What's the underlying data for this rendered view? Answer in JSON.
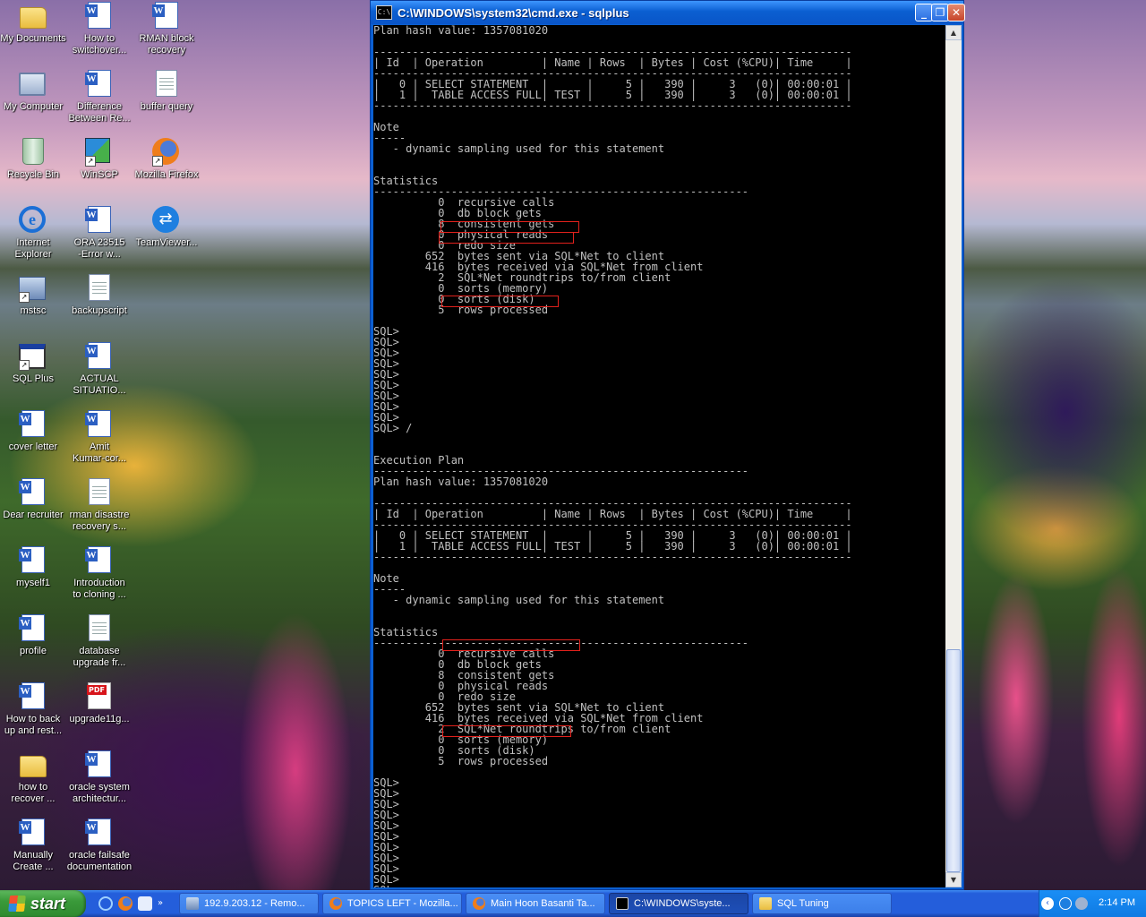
{
  "desktop": {
    "icons": [
      {
        "label": "My Documents",
        "icon": "my-documents-icon"
      },
      {
        "label": "How to\nswitchover...",
        "icon": "word-document-icon"
      },
      {
        "label": "RMAN block\nrecovery",
        "icon": "word-document-icon"
      },
      {
        "label": "My Computer",
        "icon": "my-computer-icon"
      },
      {
        "label": "Difference\nBetween Re...",
        "icon": "word-document-icon"
      },
      {
        "label": "buffer query",
        "icon": "text-document-icon"
      },
      {
        "label": "Recycle Bin",
        "icon": "recycle-bin-icon"
      },
      {
        "label": "WinSCP",
        "icon": "winscp-icon"
      },
      {
        "label": "Mozilla Firefox",
        "icon": "firefox-icon"
      },
      {
        "label": "Internet\nExplorer",
        "icon": "internet-explorer-icon"
      },
      {
        "label": "ORA 23515\n-Error w...",
        "icon": "word-document-icon"
      },
      {
        "label": "TeamViewer...",
        "icon": "teamviewer-icon"
      },
      {
        "label": "mstsc",
        "icon": "remote-desktop-icon"
      },
      {
        "label": "backupscript",
        "icon": "text-document-icon"
      },
      {
        "label": "SQL Plus",
        "icon": "sqlplus-icon"
      },
      {
        "label": "ACTUAL\nSITUATIO...",
        "icon": "word-document-icon"
      },
      {
        "label": "cover letter",
        "icon": "word-document-icon"
      },
      {
        "label": "Amit\nKumar-cor...",
        "icon": "word-document-icon"
      },
      {
        "label": "Dear recruiter",
        "icon": "word-document-icon"
      },
      {
        "label": "rman disastre\nrecovery s...",
        "icon": "text-document-icon"
      },
      {
        "label": "myself1",
        "icon": "word-document-icon"
      },
      {
        "label": "Introduction\nto cloning ...",
        "icon": "word-document-icon"
      },
      {
        "label": "profile",
        "icon": "word-document-icon"
      },
      {
        "label": "database\nupgrade fr...",
        "icon": "text-document-icon"
      },
      {
        "label": "How to back\nup and rest...",
        "icon": "word-document-icon"
      },
      {
        "label": "upgrade11g...",
        "icon": "pdf-document-icon"
      },
      {
        "label": "how to\nrecover ...",
        "icon": "folder-icon"
      },
      {
        "label": "oracle system\narchitectur...",
        "icon": "word-document-icon"
      },
      {
        "label": "Manually\nCreate ...",
        "icon": "word-document-icon"
      },
      {
        "label": "oracle failsafe\ndocumentation",
        "icon": "word-document-icon"
      }
    ]
  },
  "window": {
    "title": "C:\\WINDOWS\\system32\\cmd.exe - sqlplus",
    "icon_text": "C:\\",
    "minimize": "_",
    "maximize": "❐",
    "close": "✕",
    "console_text": "Plan hash value: 1357081020\n\n--------------------------------------------------------------------------\n| Id  | Operation         | Name | Rows  | Bytes | Cost (%CPU)| Time     |\n--------------------------------------------------------------------------\n|   0 | SELECT STATEMENT  |      |     5 |   390 |     3   (0)| 00:00:01 |\n|   1 |  TABLE ACCESS FULL| TEST |     5 |   390 |     3   (0)| 00:00:01 |\n--------------------------------------------------------------------------\n\nNote\n-----\n   - dynamic sampling used for this statement\n\n\nStatistics\n----------------------------------------------------------\n          0  recursive calls\n          0  db block gets\n          8  consistent gets\n          0  physical reads\n          0  redo size\n        652  bytes sent via SQL*Net to client\n        416  bytes received via SQL*Net from client\n          2  SQL*Net roundtrips to/from client\n          0  sorts (memory)\n          0  sorts (disk)\n          5  rows processed\n\nSQL>\nSQL>\nSQL>\nSQL>\nSQL>\nSQL>\nSQL>\nSQL>\nSQL>\nSQL> /\n\n\nExecution Plan\n----------------------------------------------------------\nPlan hash value: 1357081020\n\n--------------------------------------------------------------------------\n| Id  | Operation         | Name | Rows  | Bytes | Cost (%CPU)| Time     |\n--------------------------------------------------------------------------\n|   0 | SELECT STATEMENT  |      |     5 |   390 |     3   (0)| 00:00:01 |\n|   1 |  TABLE ACCESS FULL| TEST |     5 |   390 |     3   (0)| 00:00:01 |\n--------------------------------------------------------------------------\n\nNote\n-----\n   - dynamic sampling used for this statement\n\n\nStatistics\n----------------------------------------------------------\n          0  recursive calls\n          0  db block gets\n          8  consistent gets\n          0  physical reads\n          0  redo size\n        652  bytes sent via SQL*Net to client\n        416  bytes received via SQL*Net from client\n          2  SQL*Net roundtrips to/from client\n          0  sorts (memory)\n          0  sorts (disk)\n          5  rows processed\n\nSQL>\nSQL>\nSQL>\nSQL>\nSQL>\nSQL>\nSQL>\nSQL>\nSQL>\nSQL>\nSQL>",
    "highlighted_lines": [
      "consistent gets",
      "physical reads",
      "sorts (disk)",
      "recursive calls",
      "sorts (memory)"
    ],
    "highlight_color": "#e2211c"
  },
  "taskbar": {
    "start_label": "start",
    "tasks": [
      {
        "label": "192.9.203.12 - Remo...",
        "icon": "remote-desktop-icon",
        "active": false
      },
      {
        "label": "TOPICS LEFT - Mozilla...",
        "icon": "firefox-icon",
        "active": false
      },
      {
        "label": "Main Hoon Basanti Ta...",
        "icon": "firefox-icon",
        "active": false
      },
      {
        "label": "C:\\WINDOWS\\syste...",
        "icon": "cmd-icon",
        "active": true
      },
      {
        "label": "SQL Tuning",
        "icon": "folder-icon",
        "active": false
      }
    ],
    "clock": "2:14 PM"
  },
  "colors": {
    "taskbar": "#245edb",
    "start": "#3a9a3a",
    "console_bg": "#000000",
    "console_fg": "#c0c0c0"
  }
}
